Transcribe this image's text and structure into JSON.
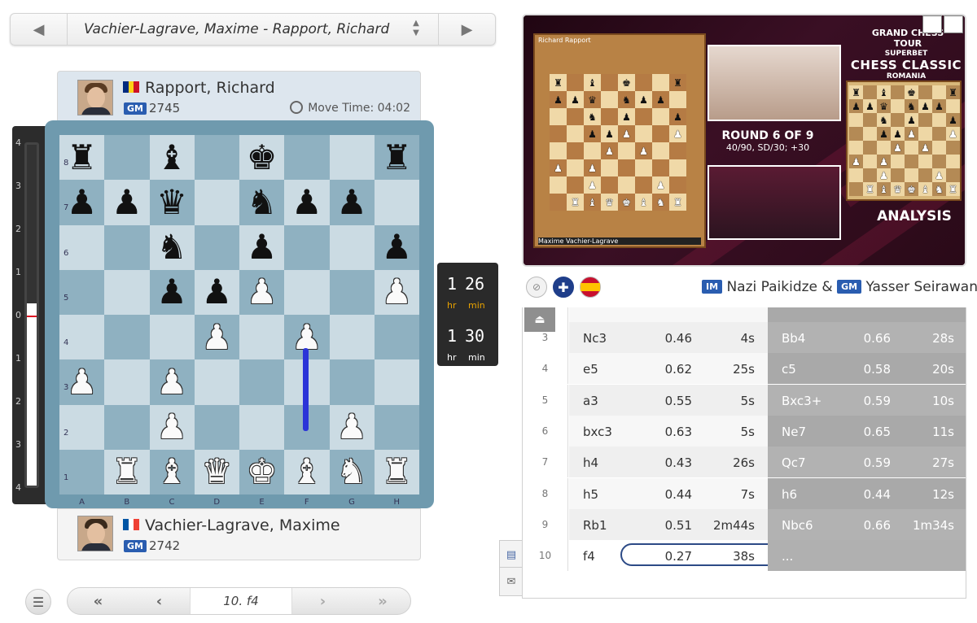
{
  "game_selector": {
    "title": "Vachier-Lagrave, Maxime - Rapport, Richard",
    "prev_icon": "chevron-left-icon",
    "next_icon": "chevron-right-icon",
    "sort_icon": "sort-icon"
  },
  "top_player": {
    "name": "Rapport, Richard",
    "title": "GM",
    "rating": "2745",
    "flag": "romania",
    "move_time_label": "Move Time: 04:02"
  },
  "bottom_player": {
    "name": "Vachier-Lagrave, Maxime",
    "title": "GM",
    "rating": "2742",
    "flag": "france"
  },
  "eval": {
    "tick_labels": [
      "4",
      "3",
      "2",
      "1",
      "0",
      "1",
      "2",
      "3",
      "4"
    ],
    "value": 0.27
  },
  "board": {
    "files": [
      "A",
      "B",
      "C",
      "D",
      "E",
      "F",
      "G",
      "H"
    ],
    "ranks": [
      "8",
      "7",
      "6",
      "5",
      "4",
      "3",
      "2",
      "1"
    ],
    "position": [
      [
        "r",
        "",
        "b",
        "",
        "k",
        "",
        "",
        "r"
      ],
      [
        "p",
        "p",
        "q",
        "",
        "n",
        "p",
        "p",
        ""
      ],
      [
        "",
        "",
        "n",
        "",
        "p",
        "",
        "",
        "p"
      ],
      [
        "",
        "",
        "p",
        "p",
        "P",
        "",
        "",
        "P"
      ],
      [
        "",
        "",
        "",
        "P",
        "",
        "P",
        "",
        ""
      ],
      [
        "P",
        "",
        "P",
        "",
        "",
        "",
        "",
        ""
      ],
      [
        "",
        "",
        "P",
        "",
        "",
        "",
        "P",
        ""
      ],
      [
        "",
        "R",
        "B",
        "Q",
        "K",
        "B",
        "N",
        "R"
      ]
    ],
    "last_move": "f2-f4"
  },
  "clocks": {
    "white": {
      "hr": "1",
      "min": "26",
      "hr_label": "hr",
      "min_label": "min"
    },
    "black": {
      "hr": "1",
      "min": "30",
      "hr_label": "hr",
      "min_label": "min"
    }
  },
  "nav": {
    "current_move": "10. f4",
    "first_icon": "double-chevron-left-icon",
    "prev_icon": "chevron-left-icon",
    "next_icon": "chevron-right-icon",
    "last_icon": "double-chevron-right-icon",
    "menu_icon": "menu-icon"
  },
  "video": {
    "gct_label": "GRAND CHESS TOUR",
    "event_line1": "SUPERBET",
    "event_line2": "CHESS CLASSIC",
    "event_line3": "ROMANIA",
    "round": "ROUND 6 OF 9",
    "time_control": "40/90, SD/30; +30",
    "analysis": "ANALYSIS",
    "overlay_white": "Maxime Vachier-Lagrave",
    "overlay_black": "Richard Rapport"
  },
  "commentary": {
    "commentator1_title": "IM",
    "commentator1": "Nazi Paikidze &",
    "commentator2_title": "GM",
    "commentator2": "Yasser Seirawan"
  },
  "moves": [
    {
      "num": "3",
      "w": "Nc3",
      "w_eval": "0.46",
      "w_time": "4s",
      "b": "Bb4",
      "b_eval": "0.66",
      "b_time": "28s"
    },
    {
      "num": "4",
      "w": "e5",
      "w_eval": "0.62",
      "w_time": "25s",
      "b": "c5",
      "b_eval": "0.58",
      "b_time": "20s"
    },
    {
      "num": "5",
      "w": "a3",
      "w_eval": "0.55",
      "w_time": "5s",
      "b": "Bxc3+",
      "b_eval": "0.59",
      "b_time": "10s"
    },
    {
      "num": "6",
      "w": "bxc3",
      "w_eval": "0.63",
      "w_time": "5s",
      "b": "Ne7",
      "b_eval": "0.65",
      "b_time": "11s"
    },
    {
      "num": "7",
      "w": "h4",
      "w_eval": "0.43",
      "w_time": "26s",
      "b": "Qc7",
      "b_eval": "0.59",
      "b_time": "27s"
    },
    {
      "num": "8",
      "w": "h5",
      "w_eval": "0.44",
      "w_time": "7s",
      "b": "h6",
      "b_eval": "0.44",
      "b_time": "12s"
    },
    {
      "num": "9",
      "w": "Rb1",
      "w_eval": "0.51",
      "w_time": "2m44s",
      "b": "Nbc6",
      "b_eval": "0.66",
      "b_time": "1m34s"
    },
    {
      "num": "10",
      "w": "f4",
      "w_eval": "0.27",
      "w_time": "38s",
      "b": "...",
      "b_eval": "",
      "b_time": ""
    }
  ],
  "colors": {
    "board_light": "#cbdbe3",
    "board_dark": "#8fb1c1",
    "arrow": "#2b34d8",
    "badge": "#2a5db0"
  }
}
